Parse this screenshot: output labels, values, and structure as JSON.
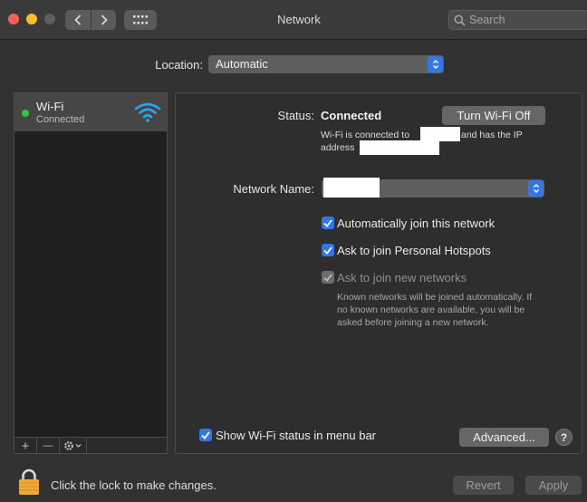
{
  "window": {
    "title": "Network"
  },
  "search": {
    "placeholder": "Search"
  },
  "location": {
    "label": "Location:",
    "value": "Automatic"
  },
  "services": [
    {
      "name": "Wi-Fi",
      "status": "Connected",
      "status_color": "#2ec940"
    }
  ],
  "status": {
    "label": "Status:",
    "value": "Connected",
    "toggle_button": "Turn Wi-Fi Off",
    "desc_part1": "Wi-Fi is connected to",
    "desc_part2": "and has the IP",
    "desc_part3": "address"
  },
  "network_name": {
    "label": "Network Name:"
  },
  "options": {
    "auto_join": {
      "label": "Automatically join this network",
      "checked": true
    },
    "ask_hotspots": {
      "label": "Ask to join Personal Hotspots",
      "checked": true
    },
    "ask_new": {
      "label": "Ask to join new networks",
      "checked": true,
      "enabled": false
    },
    "help_line1": "Known networks will be joined automatically. If",
    "help_line2": "no known networks are available, you will be",
    "help_line3": "asked before joining a new network."
  },
  "show_menu_bar": {
    "label": "Show Wi-Fi status in menu bar",
    "checked": true
  },
  "buttons": {
    "advanced": "Advanced...",
    "help": "?",
    "revert": "Revert",
    "apply": "Apply",
    "add": "+",
    "remove": "—"
  },
  "lock": {
    "text": "Click the lock to make changes."
  },
  "colors": {
    "accent": "#3277e3",
    "lock": "#f2a93b",
    "status_green": "#2ec940"
  }
}
